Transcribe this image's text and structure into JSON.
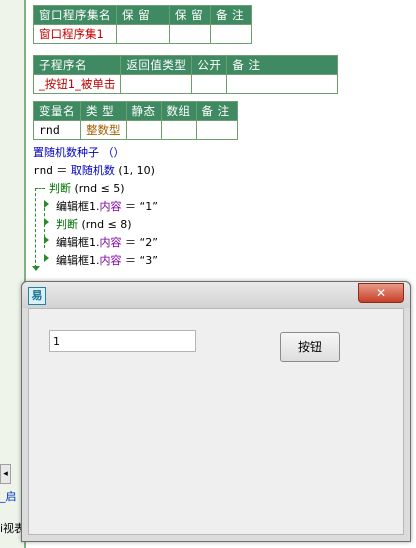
{
  "window_table": {
    "headers": [
      "窗口程序集名",
      "保 留",
      "保 留",
      "备 注"
    ],
    "row": [
      "窗口程序集1",
      "",
      "",
      ""
    ]
  },
  "sub_table": {
    "headers": [
      "子程序名",
      "返回值类型",
      "公开",
      "备 注"
    ],
    "row": [
      "_按钮1_被单击",
      "",
      "",
      ""
    ]
  },
  "var_table": {
    "headers": [
      "变量名",
      "类 型",
      "静态",
      "数组",
      "备 注"
    ],
    "row": [
      "rnd",
      "整数型",
      "",
      "",
      ""
    ]
  },
  "code": {
    "line1": "置随机数种子 （）",
    "line2_var": "rnd",
    "line2_eq": " ＝ ",
    "line2_fn": "取随机数",
    "line2_args": " (1, 10)",
    "line3_kw": "判断",
    "line3_cond": " (rnd ≤ 5)",
    "line4_obj": "编辑框1.",
    "line4_prop": "内容",
    "line4_val": " ＝ “1”",
    "line5_kw": "判断",
    "line5_cond": " (rnd ≤ 8)",
    "line6_obj": "编辑框1.",
    "line6_prop": "内容",
    "line6_val": " ＝ “2”",
    "line7_obj": "编辑框1.",
    "line7_prop": "内容",
    "line7_val": " ＝ “3”"
  },
  "ide_bottom": {
    "tab_fragment": "_启",
    "status_fragment": "i视表"
  },
  "popup": {
    "app_icon": "易",
    "close_label": "✕",
    "textbox_value": "1",
    "button_label": "按钮"
  }
}
